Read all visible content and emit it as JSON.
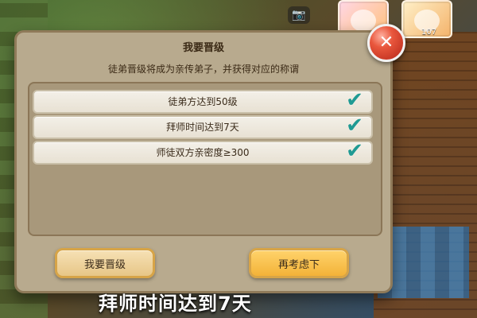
{
  "hud": {
    "level_text": "107"
  },
  "dialog": {
    "title": "我要晋级",
    "subtitle": "徒弟晋级将成为亲传弟子，并获得对应的称谓",
    "requirements": [
      {
        "text": "徒弟方达到50级",
        "checked": true
      },
      {
        "text": "拜师时间达到7天",
        "checked": true
      },
      {
        "text": "师徒双方亲密度≥300",
        "checked": true
      }
    ],
    "buttons": {
      "upgrade": "我要晋级",
      "reconsider": "再考虑下"
    },
    "close_icon": "close-icon"
  },
  "caption": {
    "text": "拜师时间达到7天"
  },
  "colors": {
    "check": "#1f9a93",
    "close_button": "#e9573d",
    "primary_button": "#f3b238"
  }
}
